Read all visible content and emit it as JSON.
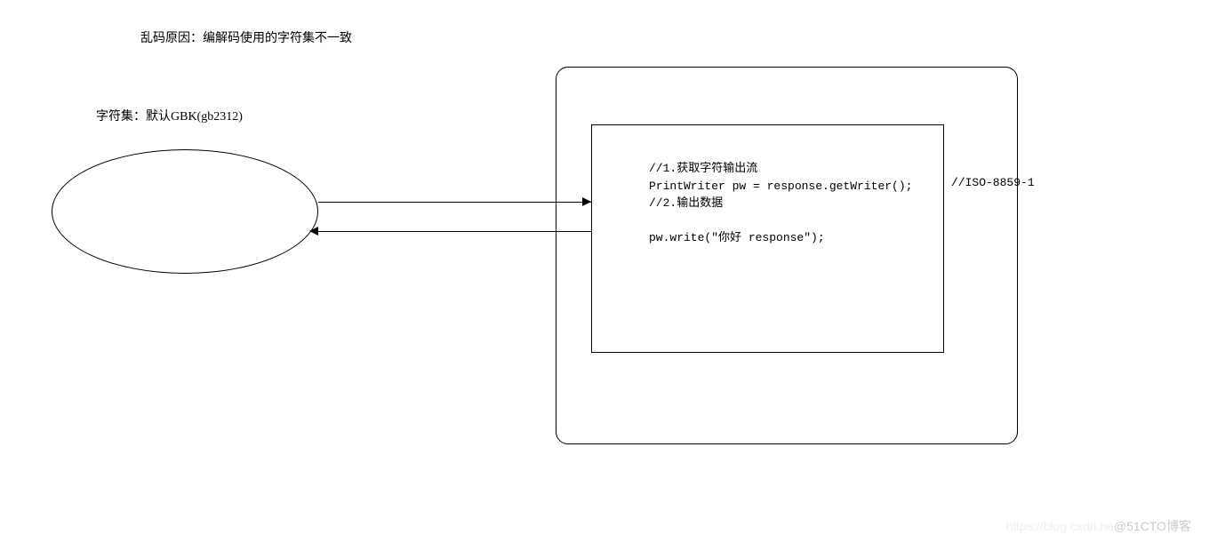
{
  "diagram": {
    "title": "乱码原因：编解码使用的字符集不一致",
    "charset_label": "字符集：默认GBK(gb2312)",
    "code": {
      "line1": "//1.获取字符输出流",
      "line2": "PrintWriter pw = response.getWriter();",
      "line3": "//2.输出数据",
      "line4": "",
      "line5": "pw.write(\"你好 response\");"
    },
    "iso_comment": "//ISO-8859-1",
    "watermark_faint": "https://blog.csdn.ne",
    "watermark": "@51CTO博客"
  }
}
